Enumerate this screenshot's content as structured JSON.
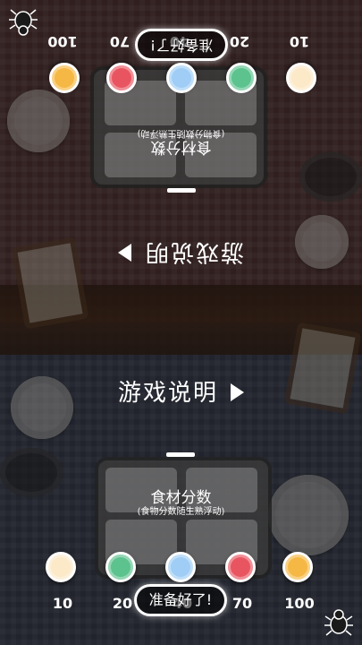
{
  "instructions_label": "游戏说明",
  "score_title": "食材分数",
  "score_subtitle": "(食物分数随生熟浮动)",
  "ready_button": "准备好了!",
  "tokens": [
    {
      "score": "10",
      "color": "#fbe9c8"
    },
    {
      "score": "20",
      "color": "#5cc28e"
    },
    {
      "score": "40",
      "color": "#9fcdf5"
    },
    {
      "score": "70",
      "color": "#e85561"
    },
    {
      "score": "100",
      "color": "#f6b844"
    }
  ],
  "icons": {
    "corner": "bug-icon",
    "arrow": "triangle-right-icon"
  }
}
